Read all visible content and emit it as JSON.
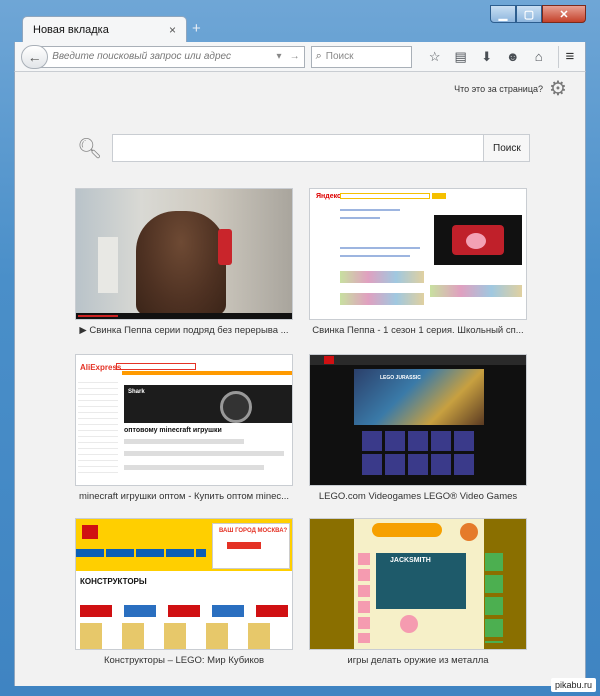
{
  "window": {
    "minimize_icon": "minimize-icon",
    "maximize_icon": "maximize-icon",
    "close_icon": "close-icon"
  },
  "tab": {
    "title": "Новая вкладка",
    "close": "×",
    "new_tab": "+"
  },
  "toolbar": {
    "back": "←",
    "url_placeholder": "Введите поисковый запрос или адрес",
    "url_dropdown": "▾",
    "url_go": "→",
    "search_placeholder": "Поиск",
    "icons": [
      "bookmark-star-icon",
      "bookmarks-list-icon",
      "downloads-icon",
      "chat-icon",
      "home-icon"
    ],
    "menu": "≡"
  },
  "newtab": {
    "what_is_this": "Что это за страница?",
    "search_button": "Поиск",
    "tiles": [
      {
        "label": "▶ Свинка Пеппа серии подряд без перерыва ..."
      },
      {
        "label": "Свинка Пеппа - 1 сезон 1 серия. Школьный сп..."
      },
      {
        "label": "minecraft игрушки оптом - Купить оптом minec..."
      },
      {
        "label": "LEGO.com Videogames LEGO® Video Games"
      },
      {
        "label": "Конструкторы – LEGO: Мир Кубиков"
      },
      {
        "label": "игры делать оружие из металла"
      }
    ],
    "thumbs": {
      "yandex": "Яндекс",
      "ali": "AliExpress",
      "shark": "Shark",
      "ali_head": "оптовому minecraft игрушки",
      "lego_promo": "ВАШ ГОРОД МОСКВА?",
      "lego_title": "КОНСТРУКТОРЫ"
    }
  },
  "watermark": "pikabu.ru"
}
